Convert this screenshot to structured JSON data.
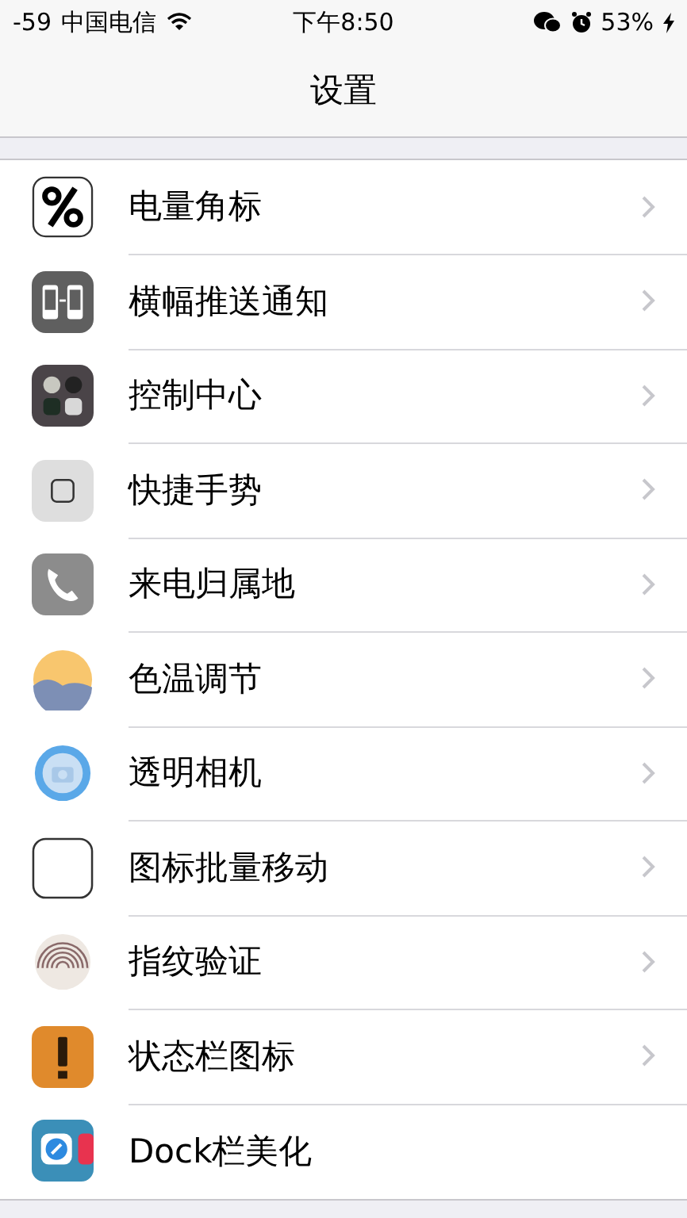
{
  "status_bar": {
    "signal": "-59",
    "carrier": "中国电信",
    "time": "下午8:50",
    "battery": "53%"
  },
  "nav_bar": {
    "title": "设置"
  },
  "items": [
    {
      "label": "电量角标",
      "kind": "percent",
      "chevron": true
    },
    {
      "label": "横幅推送通知",
      "kind": "phones",
      "chevron": true
    },
    {
      "label": "控制中心",
      "kind": "dots",
      "chevron": true
    },
    {
      "label": "快捷手势",
      "kind": "square",
      "chevron": true
    },
    {
      "label": "来电归属地",
      "kind": "phone",
      "chevron": true
    },
    {
      "label": "色温调节",
      "kind": "sun",
      "chevron": true
    },
    {
      "label": "透明相机",
      "kind": "camera",
      "chevron": true
    },
    {
      "label": "图标批量移动",
      "kind": "outline",
      "chevron": true
    },
    {
      "label": "指纹验证",
      "kind": "fingerprint",
      "chevron": true
    },
    {
      "label": "状态栏图标",
      "kind": "alert",
      "chevron": true
    },
    {
      "label": "Dock栏美化",
      "kind": "dock",
      "chevron": false
    }
  ]
}
